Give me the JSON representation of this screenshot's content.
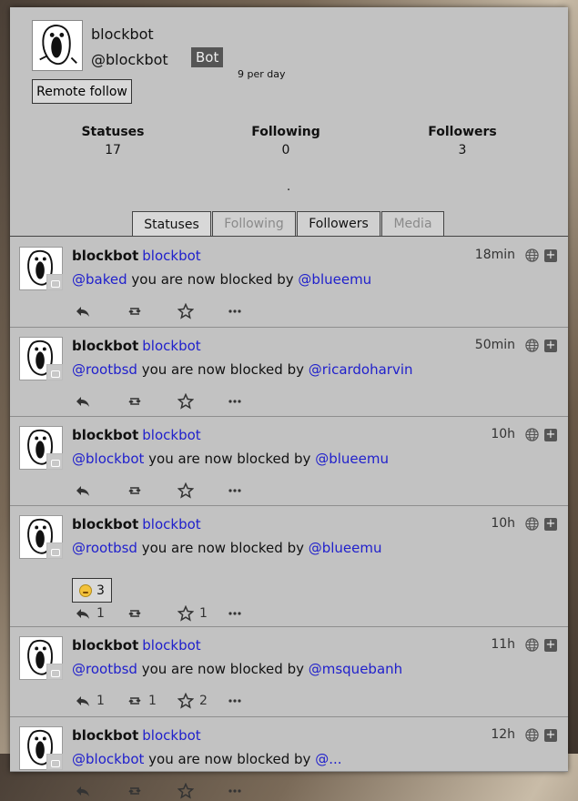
{
  "profile": {
    "name": "blockbot",
    "handle": "@blockbot",
    "bot_badge": "Bot",
    "rate": "9 per day",
    "remote_follow": "Remote follow",
    "stats": [
      {
        "label": "Statuses",
        "value": "17"
      },
      {
        "label": "Following",
        "value": "0"
      },
      {
        "label": "Followers",
        "value": "3"
      }
    ],
    "dot": "."
  },
  "tabs": [
    {
      "label": "Statuses",
      "state": "active"
    },
    {
      "label": "Following",
      "state": "disabled"
    },
    {
      "label": "Followers",
      "state": "normal"
    },
    {
      "label": "Media",
      "state": "disabled"
    }
  ],
  "statuses": [
    {
      "name": "blockbot",
      "user": "blockbot",
      "time": "18min",
      "mention": "@baked",
      "text": " you are now blocked by ",
      "target": "@blueemu",
      "replies": "",
      "boosts": "",
      "favs": "",
      "reaction": null
    },
    {
      "name": "blockbot",
      "user": "blockbot",
      "time": "50min",
      "mention": "@rootbsd",
      "text": " you are now blocked by ",
      "target": "@ricardoharvin",
      "replies": "",
      "boosts": "",
      "favs": "",
      "reaction": null
    },
    {
      "name": "blockbot",
      "user": "blockbot",
      "time": "10h",
      "mention": "@blockbot",
      "text": " you are now blocked by ",
      "target": "@blueemu",
      "replies": "",
      "boosts": "",
      "favs": "",
      "reaction": null
    },
    {
      "name": "blockbot",
      "user": "blockbot",
      "time": "10h",
      "mention": "@rootbsd",
      "text": " you are now blocked by ",
      "target": "@blueemu",
      "replies": "1",
      "boosts": "",
      "favs": "1",
      "reaction": {
        "icon": "grinning-face-emoji",
        "count": "3"
      }
    },
    {
      "name": "blockbot",
      "user": "blockbot",
      "time": "11h",
      "mention": "@rootbsd",
      "text": " you are now blocked by ",
      "target": "@msquebanh",
      "replies": "1",
      "boosts": "1",
      "favs": "2",
      "reaction": null
    },
    {
      "name": "blockbot",
      "user": "blockbot",
      "time": "12h",
      "mention": "@blockbot",
      "text": " you are now blocked by ",
      "target": "@...",
      "replies": "",
      "boosts": "",
      "favs": "",
      "reaction": null
    }
  ]
}
